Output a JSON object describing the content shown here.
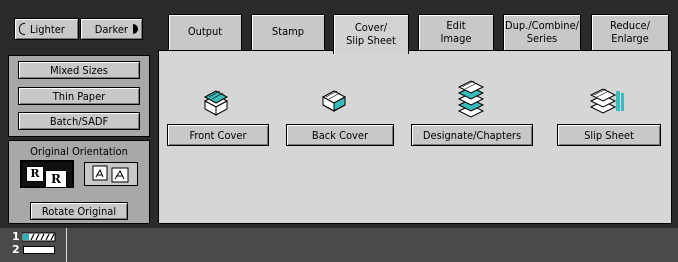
{
  "density": {
    "lighter_label": "Lighter",
    "darker_label": "Darker"
  },
  "paper_options": {
    "mixed_sizes": "Mixed Sizes",
    "thin_paper": "Thin Paper",
    "batch_sadf": "Batch/SADF"
  },
  "orientation": {
    "title": "Original Orientation",
    "rotate_label": "Rotate Original",
    "readable_glyph": "R"
  },
  "tabs": [
    {
      "label": "Output"
    },
    {
      "label": "Stamp"
    },
    {
      "label": "Cover/\nSlip Sheet"
    },
    {
      "label": "Edit\nImage"
    },
    {
      "label": "Dup./Combine/\nSeries"
    },
    {
      "label": "Reduce/\nEnlarge"
    }
  ],
  "cover_functions": {
    "front_cover": "Front Cover",
    "back_cover": "Back Cover",
    "designate_chapters": "Designate/Chapters",
    "slip_sheet": "Slip Sheet"
  },
  "status": {
    "line1": "1",
    "line2": "2"
  },
  "colors": {
    "panel_bg": "#2a2a2a",
    "button_bg": "#c8c8c8",
    "content_bg": "#d6d6d6",
    "icon_accent": "#2ab3b3"
  }
}
